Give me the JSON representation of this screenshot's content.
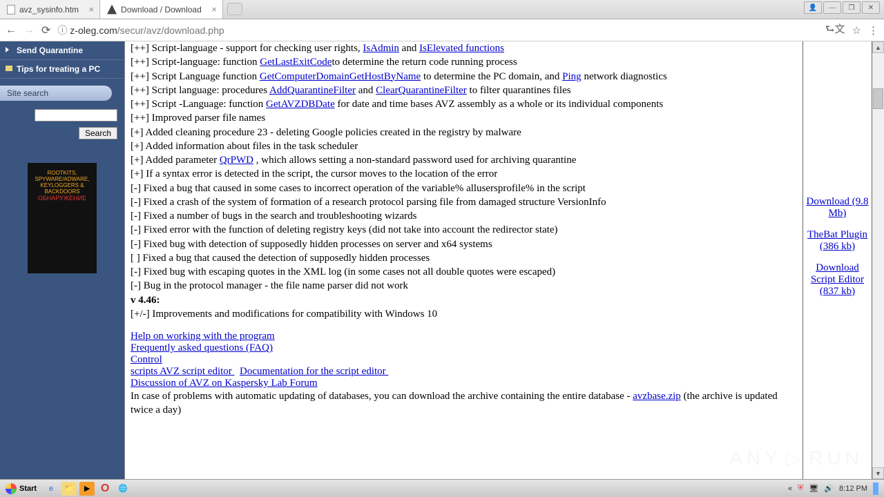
{
  "tabs": [
    {
      "title": "avz_sysinfo.htm"
    },
    {
      "title": "Download / Download"
    }
  ],
  "url": {
    "info_icon": "ⓘ",
    "host": "z-oleg.com",
    "path": "/secur/avz/download.php"
  },
  "sidebar": {
    "items": [
      "Send Quarantine",
      "Tips for treating a PC"
    ],
    "search_header": "Site search",
    "search_button": "Search",
    "book": {
      "l1": "ROOTKITS,",
      "l2": "SPYWARE/ADWARE,",
      "l3": "KEYLOGGERS &",
      "l4": "BACKDOORS"
    }
  },
  "changelog": [
    {
      "pre": "[++] Script-language - support for checking user rights, ",
      "link": "IsAdmin",
      "mid": " and ",
      "link2": "IsElevated functions",
      "post": ""
    },
    {
      "pre": "[++] Script-language: function ",
      "link": "GetLastExitCode",
      "post": "to determine the return code running process"
    },
    {
      "pre": "[++] Script Language function ",
      "link": "GetComputerDomain",
      "post": " to determine the PC domain, ",
      "link2": "GetHostByName",
      "mid2": " and ",
      "link3": "Ping",
      "post2": " network diagnostics"
    },
    {
      "pre": "[++] Script language: procedures ",
      "link": "AddQuarantineFilter",
      "mid": " and ",
      "link2": "ClearQuarantineFilter",
      "post": " to filter quarantines files"
    },
    {
      "pre": "[++] Script -Language: function ",
      "link": "GetAVZDBDate",
      "post": " for date and time bases AVZ assembly as a whole or its individual components"
    },
    {
      "pre": "[++] Improved parser file names"
    },
    {
      "pre": "[+] Added cleaning procedure 23 - deleting Google policies created in the registry by malware"
    },
    {
      "pre": "[+] Added information about files in the task scheduler"
    },
    {
      "pre": "[+] Added parameter ",
      "link": "QrPWD",
      "post": " , which allows setting a non-standard password used for archiving quarantine"
    },
    {
      "pre": "[+] If a syntax error is detected in the script, the cursor moves to the location of the error"
    },
    {
      "pre": "[-] Fixed a bug that caused in some cases to incorrect operation of the variable% allusersprofile% in the script"
    },
    {
      "pre": "[-] Fixed a crash of the system of formation of a research protocol parsing file from damaged structure VersionInfo"
    },
    {
      "pre": "[-] Fixed a number of bugs in the search and troubleshooting wizards"
    },
    {
      "pre": "[-] Fixed error with the function of deleting registry keys (did not take into account the redirector state)"
    },
    {
      "pre": "[-] Fixed bug with detection of supposedly hidden processes on server and x64 systems"
    },
    {
      "pre": "[ ] Fixed a bug that caused the detection of supposedly hidden processes"
    },
    {
      "pre": "[-] Fixed bug with escaping quotes in the XML log (in some cases not all double quotes were escaped)"
    },
    {
      "pre": "[-] Bug in the protocol manager - the file name parser did not work"
    }
  ],
  "version_header": "v 4.46:",
  "version_line": "[+/-] Improvements and modifications for compatibility with Windows 10",
  "bottom_links": [
    "Help on working with the program ",
    "Frequently asked questions (FAQ) ",
    "Control ",
    "scripts AVZ script editor ",
    "Documentation for the script editor ",
    "Discussion of AVZ on Kaspersky Lab Forum"
  ],
  "dbnote_pre": "In case of problems with automatic updating of databases, you can download the archive containing the entire database - ",
  "dbnote_link": "avzbase.zip",
  "dbnote_post": "   (the archive is updated twice a day)",
  "downloads": [
    {
      "l1": "Download",
      "l2": "(9.8 Mb)"
    },
    {
      "l1": "TheBat Plugin",
      "l2": "(386 kb)"
    },
    {
      "l1": "Download Script Editor",
      "l2": "(837 kb)"
    }
  ],
  "taskbar": {
    "start": "Start",
    "time": "8:12 PM"
  },
  "watermark": {
    "t1": "ANY",
    "t2": "RUN"
  }
}
